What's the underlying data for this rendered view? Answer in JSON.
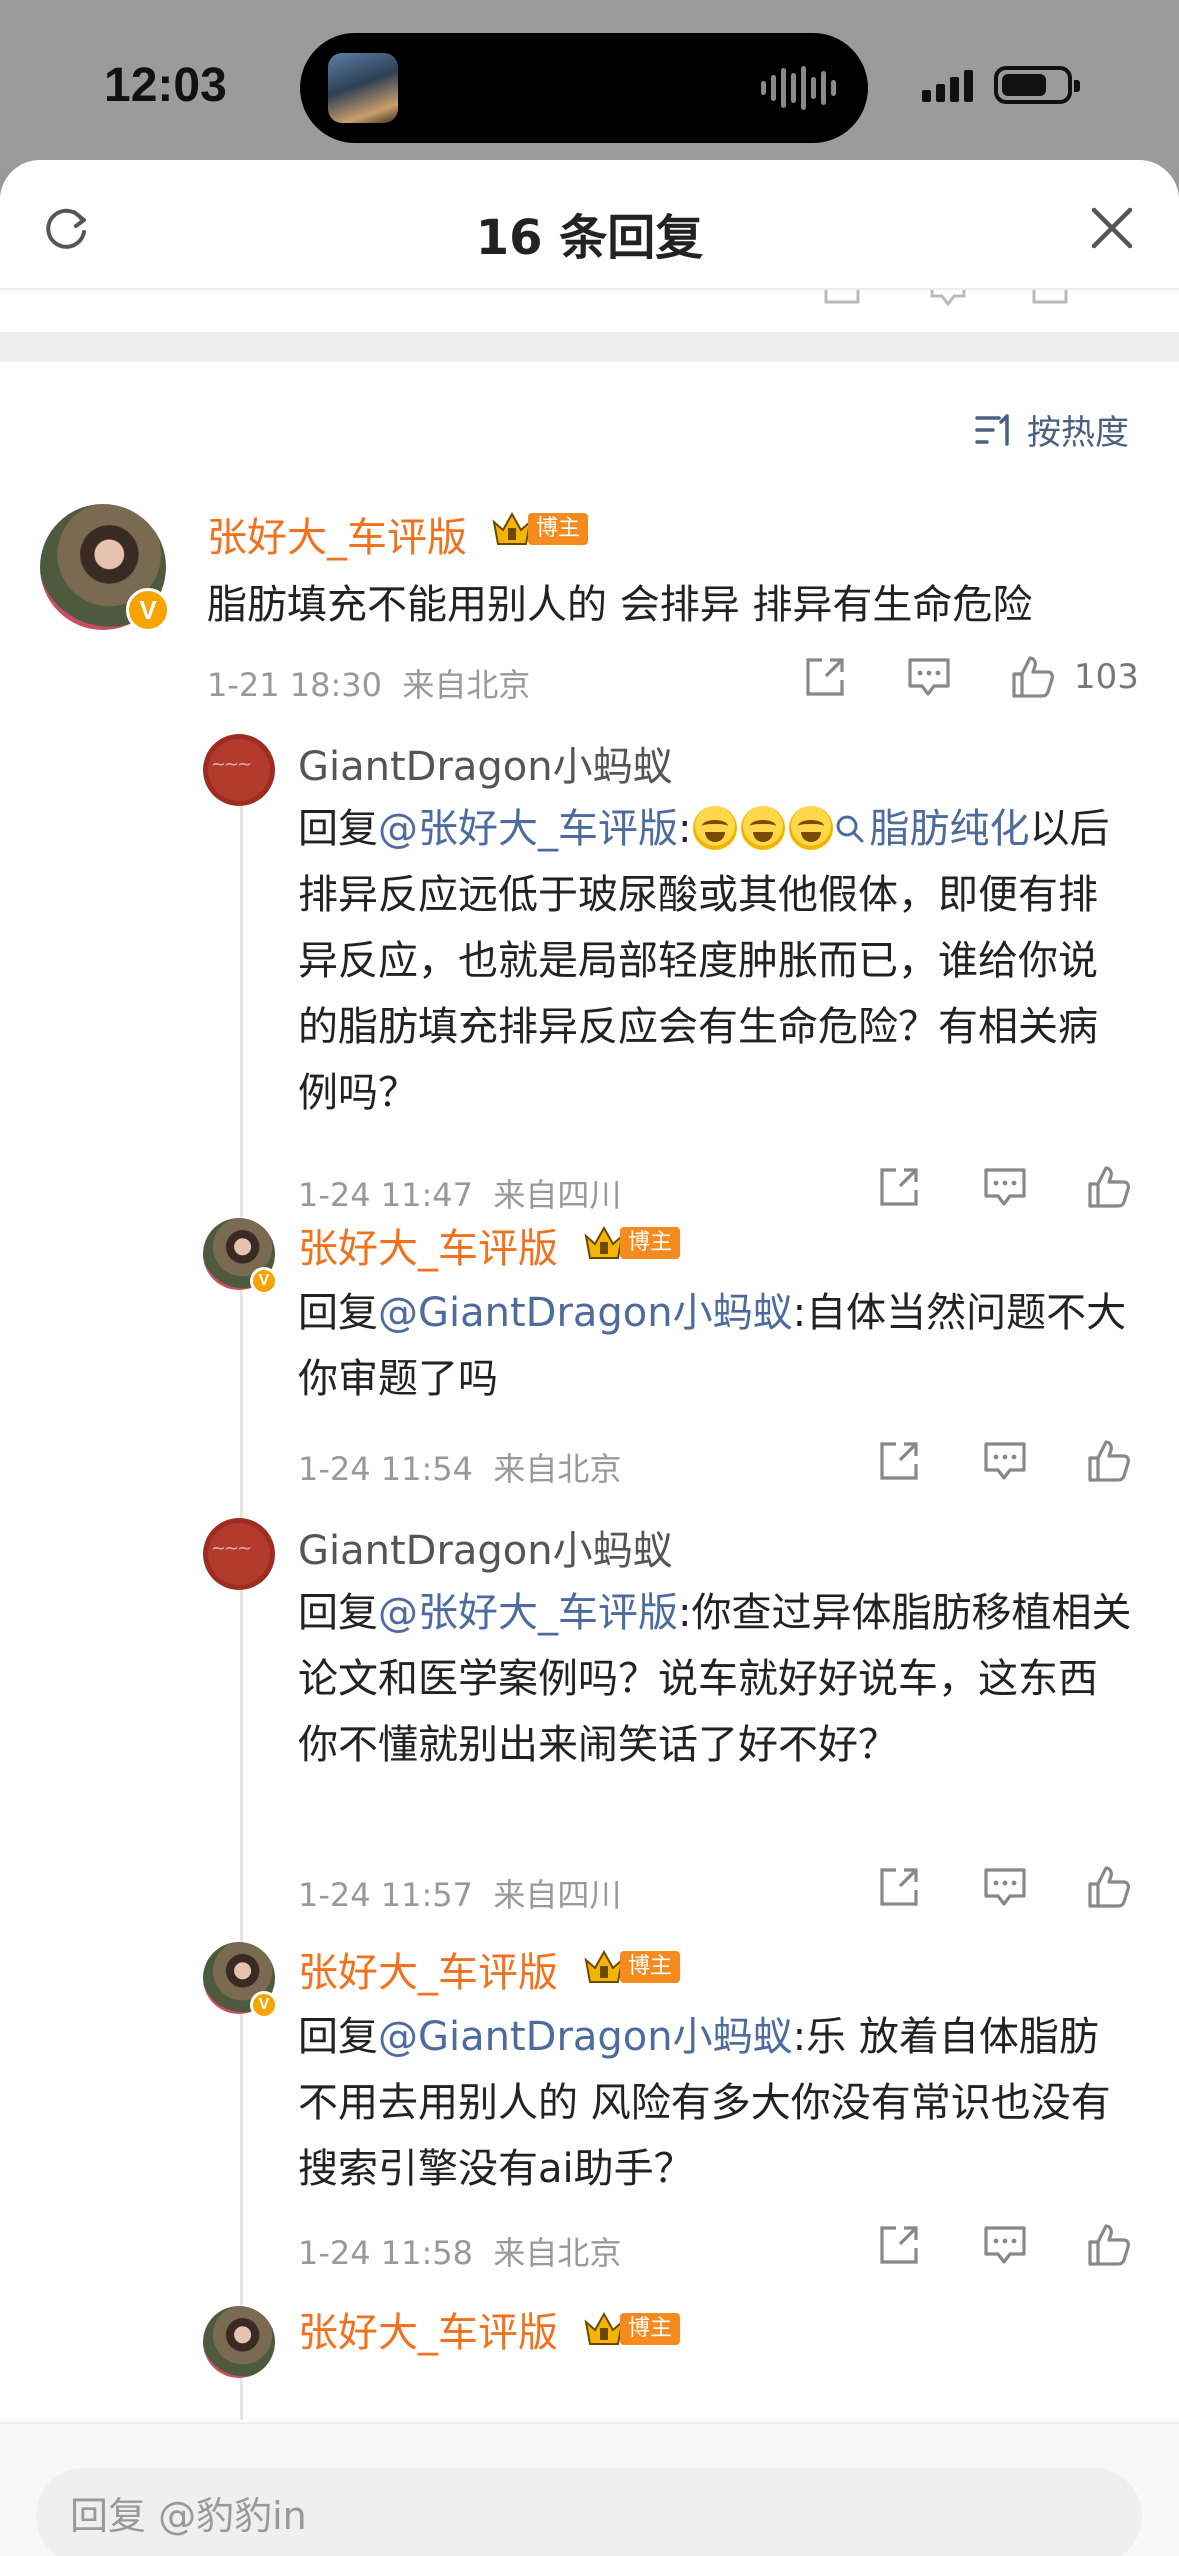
{
  "status_bar": {
    "time": "12:03"
  },
  "header": {
    "title": "16 条回复"
  },
  "sort": {
    "label": "按热度"
  },
  "root_comment": {
    "username": "张好大_车评版",
    "badge": "博主",
    "text": "脂肪填充不能用别人的 会排异 排异有生命危险",
    "date": "1-21 18:30",
    "location": "来自北京",
    "likes": "103"
  },
  "replies": [
    {
      "username": "GiantDragon小蚂蚁",
      "reply_prefix": "回复",
      "mention": "@张好大_车评版",
      "colon": ":",
      "topic": "脂肪纯化",
      "text": "以后排异反应远低于玻尿酸或其他假体，即便有排异反应，也就是局部轻度肿胀而已，谁给你说的脂肪填充排异反应会有生命危险？有相关病例吗？",
      "date": "1-24 11:47",
      "location": "来自四川"
    },
    {
      "username": "张好大_车评版",
      "badge": "博主",
      "reply_prefix": "回复",
      "mention": "@GiantDragon小蚂蚁",
      "colon": ":",
      "text": "自体当然问题不大 你审题了吗",
      "date": "1-24 11:54",
      "location": "来自北京"
    },
    {
      "username": "GiantDragon小蚂蚁",
      "reply_prefix": "回复",
      "mention": "@张好大_车评版",
      "colon": ":",
      "text": "你查过异体脂肪移植相关论文和医学案例吗？说车就好好说车，这东西你不懂就别出来闹笑话了好不好？",
      "date": "1-24 11:57",
      "location": "来自四川"
    },
    {
      "username": "张好大_车评版",
      "badge": "博主",
      "reply_prefix": "回复",
      "mention": "@GiantDragon小蚂蚁",
      "colon": ":",
      "text": "乐 放着自体脂肪不用去用别人的 风险有多大你没有常识也没有搜索引擎没有ai助手？",
      "date": "1-24 11:58",
      "location": "来自北京"
    }
  ],
  "bottom": {
    "reply_placeholder": "回复 @豹豹in"
  },
  "icons": [
    "refresh-icon",
    "close-icon",
    "sort-icon",
    "share-icon",
    "comment-icon",
    "like-icon",
    "verified-icon",
    "crown-icon",
    "search-icon"
  ],
  "colors": {
    "accent_orange": "#f2711c",
    "link_blue": "#4d6b9e",
    "badge_orange": "#f58a1f",
    "verified_gold": "#f5a400"
  }
}
